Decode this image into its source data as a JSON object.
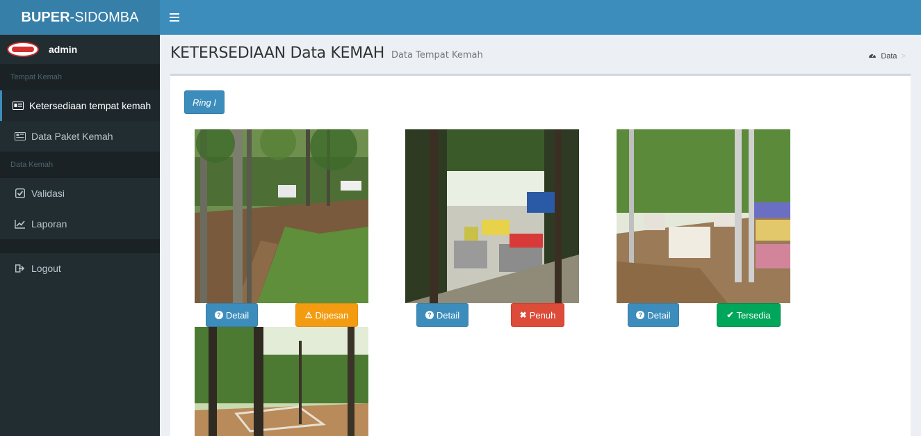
{
  "app": {
    "brand_bold": "BUPER",
    "brand_rest": "-SIDOMBA"
  },
  "user": {
    "name": "admin"
  },
  "sidebar": {
    "header_1": "Tempat Kemah",
    "items_1": [
      {
        "label": "Ketersediaan tempat kemah",
        "icon": "id-card-icon",
        "active": true
      },
      {
        "label": "Data Paket Kemah",
        "icon": "newspaper-icon",
        "active": false
      }
    ],
    "header_2": "Data Kemah",
    "items_2": [
      {
        "label": "Validasi",
        "icon": "check-square-icon"
      },
      {
        "label": "Laporan",
        "icon": "line-chart-icon"
      }
    ],
    "logout": {
      "label": "Logout",
      "icon": "sign-out-icon"
    }
  },
  "page": {
    "title": "KETERSEDIAAN Data KEMAH",
    "subtitle": "Data Tempat Kemah"
  },
  "breadcrumb": {
    "label": "Data",
    "icon": "dashboard-icon"
  },
  "ring_button": "Ring I",
  "cards": [
    {
      "detail_label": "Detail",
      "status_label": "Dipesan",
      "status_color": "#f39c12"
    },
    {
      "detail_label": "Detail",
      "status_label": "Penuh",
      "status_color": "#dd4b39"
    },
    {
      "detail_label": "Detail",
      "status_label": "Tersedia",
      "status_color": "#00a65a"
    }
  ],
  "colors": {
    "primary": "#3c8dbc",
    "sidebar_bg": "#222d32"
  }
}
